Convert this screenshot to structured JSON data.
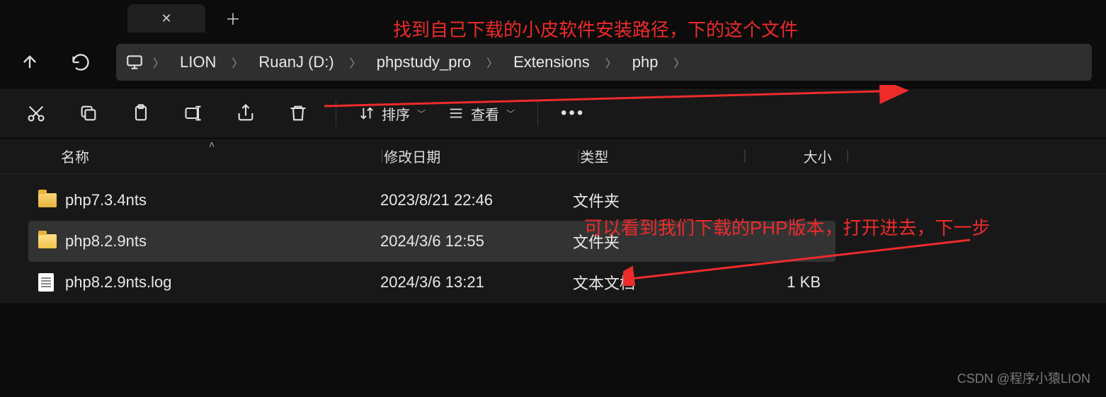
{
  "breadcrumb": {
    "items": [
      "LION",
      "RuanJ (D:)",
      "phpstudy_pro",
      "Extensions",
      "php"
    ]
  },
  "toolbar": {
    "sort_label": "排序",
    "view_label": "查看"
  },
  "columns": {
    "name": "名称",
    "modified": "修改日期",
    "type": "类型",
    "size": "大小"
  },
  "files": [
    {
      "icon": "folder",
      "name": "php7.3.4nts",
      "date": "2023/8/21 22:46",
      "type": "文件夹",
      "size": ""
    },
    {
      "icon": "folder-open",
      "name": "php8.2.9nts",
      "date": "2024/3/6 12:55",
      "type": "文件夹",
      "size": ""
    },
    {
      "icon": "file",
      "name": "php8.2.9nts.log",
      "date": "2024/3/6 13:21",
      "type": "文本文档",
      "size": "1 KB"
    }
  ],
  "annotations": {
    "top": "找到自己下载的小皮软件安装路径，下的这个文件",
    "mid": "可以看到我们下载的PHP版本，打开进去，下一步"
  },
  "watermark": "CSDN @程序小猿LION"
}
